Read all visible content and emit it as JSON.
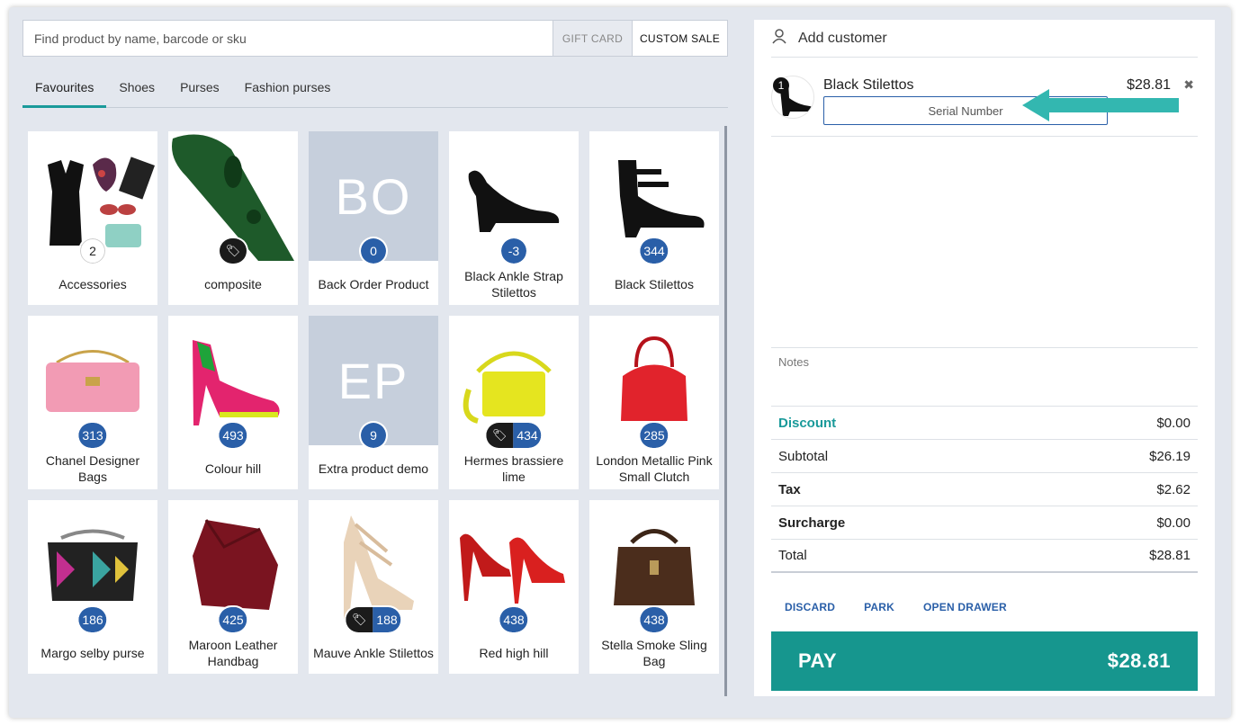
{
  "search": {
    "placeholder": "Find product by name, barcode or sku",
    "gift_card": "GIFT CARD",
    "custom_sale": "CUSTOM SALE"
  },
  "tabs": [
    "Favourites",
    "Shoes",
    "Purses",
    "Fashion purses"
  ],
  "active_tab": "Favourites",
  "products": [
    {
      "name": "Accessories",
      "badge": "2",
      "badge_style": "white",
      "icon": "accessories-image"
    },
    {
      "name": "composite",
      "badge": "",
      "tag": true,
      "icon": "scanner-image"
    },
    {
      "name": "Back Order Product",
      "badge": "0",
      "initials": "BO"
    },
    {
      "name": "Black Ankle Strap Stilettos",
      "badge": "-3",
      "icon": "black-pump-image"
    },
    {
      "name": "Black Stilettos",
      "badge": "344",
      "icon": "black-strap-heel-image"
    },
    {
      "name": "Chanel Designer Bags",
      "badge": "313",
      "icon": "pink-bag-image"
    },
    {
      "name": "Colour hill",
      "badge": "493",
      "icon": "colour-heel-image"
    },
    {
      "name": "Extra product demo",
      "badge": "9",
      "initials": "EP"
    },
    {
      "name": "Hermes brassiere lime",
      "badge": "434",
      "tag": true,
      "icon": "lime-bag-image"
    },
    {
      "name": "London Metallic Pink Small Clutch",
      "badge": "285",
      "icon": "red-bag-image"
    },
    {
      "name": "Margo selby purse",
      "badge": "186",
      "icon": "purse-image"
    },
    {
      "name": "Maroon Leather Handbag",
      "badge": "425",
      "icon": "maroon-bag-image"
    },
    {
      "name": "Mauve Ankle Stilettos",
      "badge": "188",
      "tag": true,
      "icon": "mauve-heel-image"
    },
    {
      "name": "Red high hill",
      "badge": "438",
      "icon": "red-heel-image"
    },
    {
      "name": "Stella Smoke Sling Bag",
      "badge": "438",
      "icon": "brown-bag-image"
    }
  ],
  "customer": {
    "label": "Add customer"
  },
  "cart": {
    "item": {
      "qty": "1",
      "name": "Black Stilettos",
      "price": "$28.81",
      "remove": "✖",
      "serial_placeholder": "Serial Number"
    }
  },
  "notes": {
    "placeholder": "Notes"
  },
  "totals": {
    "discount": {
      "label": "Discount",
      "value": "$0.00"
    },
    "subtotal": {
      "label": "Subtotal",
      "value": "$26.19"
    },
    "tax": {
      "label": "Tax",
      "value": "$2.62"
    },
    "surcharge": {
      "label": "Surcharge",
      "value": "$0.00"
    },
    "total": {
      "label": "Total",
      "value": "$28.81"
    }
  },
  "actions": {
    "discard": "DISCARD",
    "park": "PARK",
    "open_drawer": "OPEN DRAWER"
  },
  "pay": {
    "label": "PAY",
    "amount": "$28.81"
  },
  "colors": {
    "accent": "#16968e",
    "badge": "#2a5fa8",
    "tag": "#1b1b1b"
  }
}
